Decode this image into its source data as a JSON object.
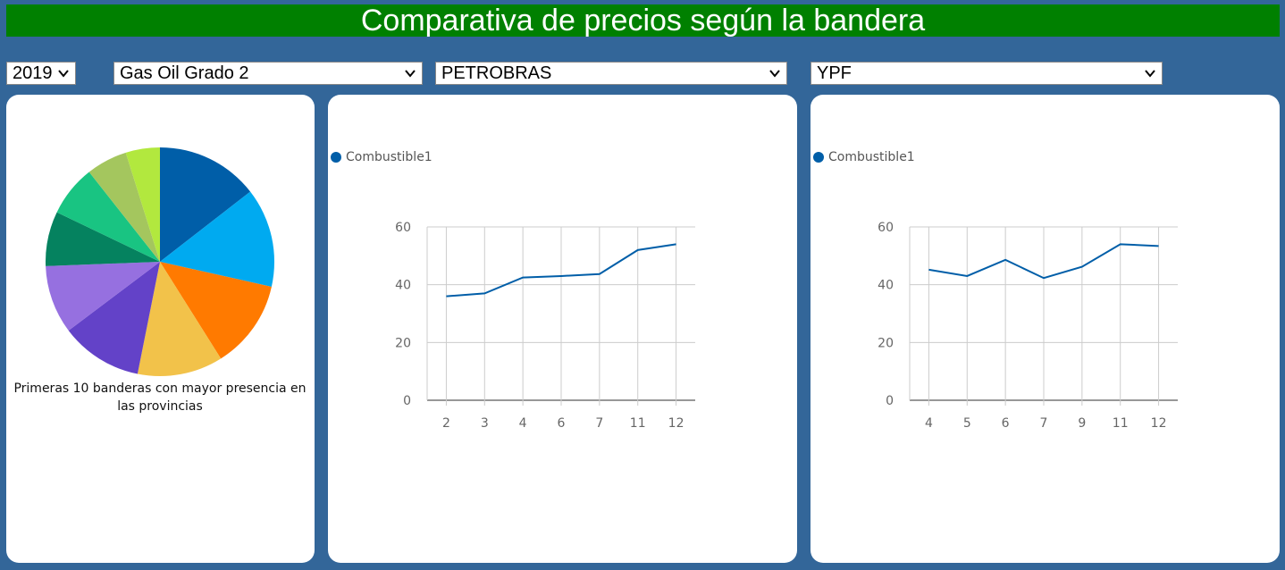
{
  "header": {
    "title": "Comparativa de precios según la bandera"
  },
  "selects": {
    "year": "2019",
    "fuel": "Gas Oil Grado 2",
    "flag_left": "PETROBRAS",
    "flag_right": "YPF"
  },
  "pie_caption": "Primeras 10 banderas con mayor presencia en las provincias",
  "colors": {
    "background": "#336699",
    "title_bar": "#008000",
    "line": "#005ea8"
  },
  "chart_data": [
    {
      "type": "pie",
      "caption": "Primeras 10 banderas con mayor presencia en las provincias",
      "values": [
        15,
        14.5,
        13,
        12.5,
        12,
        10,
        8,
        7.5,
        6,
        5
      ],
      "colors": [
        "#005ea8",
        "#00aaf0",
        "#ff7a00",
        "#f2c24a",
        "#6342c8",
        "#9670e0",
        "#05825f",
        "#19c482",
        "#a4c65e",
        "#b2e83e"
      ]
    },
    {
      "type": "line",
      "legend": [
        "Combustible1"
      ],
      "categories": [
        "2",
        "3",
        "4",
        "6",
        "7",
        "11",
        "12"
      ],
      "series": [
        {
          "name": "Combustible1",
          "values": [
            36,
            37,
            42.5,
            43,
            43.7,
            52,
            54
          ],
          "color": "#005ea8"
        }
      ],
      "yticks": [
        0,
        20,
        40,
        60
      ],
      "ylim": [
        0,
        60
      ],
      "grid": true
    },
    {
      "type": "line",
      "legend": [
        "Combustible1"
      ],
      "categories": [
        "4",
        "5",
        "6",
        "7",
        "9",
        "11",
        "12"
      ],
      "series": [
        {
          "name": "Combustible1",
          "values": [
            45.2,
            43,
            48.6,
            42.3,
            46.2,
            54,
            53.4
          ],
          "color": "#005ea8"
        }
      ],
      "yticks": [
        0,
        20,
        40,
        60
      ],
      "ylim": [
        0,
        60
      ],
      "grid": true
    }
  ]
}
